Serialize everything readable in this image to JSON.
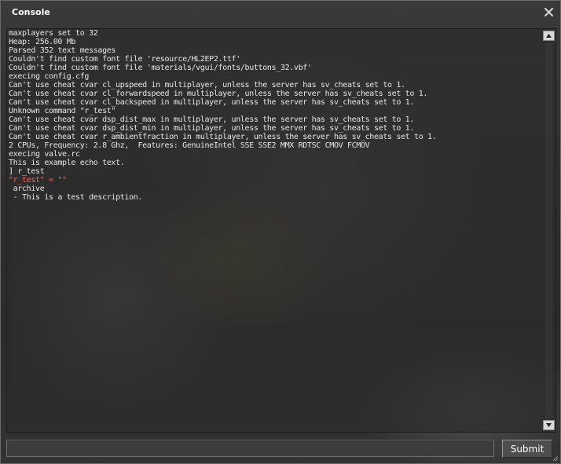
{
  "window": {
    "title": "Console"
  },
  "console": {
    "lines": [
      {
        "text": "maxplayers set to 32",
        "kind": "normal"
      },
      {
        "text": "Heap: 256.00 Mb",
        "kind": "normal"
      },
      {
        "text": "Parsed 352 text messages",
        "kind": "normal"
      },
      {
        "text": "Couldn't find custom font file 'resource/HL2EP2.ttf'",
        "kind": "normal"
      },
      {
        "text": "Couldn't find custom font file 'materials/vgui/fonts/buttons_32.vbf'",
        "kind": "normal"
      },
      {
        "text": "execing config.cfg",
        "kind": "normal"
      },
      {
        "text": "Can't use cheat cvar cl_upspeed in multiplayer, unless the server has sv_cheats set to 1.",
        "kind": "normal"
      },
      {
        "text": "Can't use cheat cvar cl_forwardspeed in multiplayer, unless the server has sv_cheats set to 1.",
        "kind": "normal"
      },
      {
        "text": "Can't use cheat cvar cl_backspeed in multiplayer, unless the server has sv_cheats set to 1.",
        "kind": "normal"
      },
      {
        "text": "Unknown command \"r_test\"",
        "kind": "normal"
      },
      {
        "text": "Can't use cheat cvar dsp_dist_max in multiplayer, unless the server has sv_cheats set to 1.",
        "kind": "normal"
      },
      {
        "text": "Can't use cheat cvar dsp_dist_min in multiplayer, unless the server has sv_cheats set to 1.",
        "kind": "normal"
      },
      {
        "text": "Can't use cheat cvar r_ambientfraction in multiplayer, unless the server has sv_cheats set to 1.",
        "kind": "normal"
      },
      {
        "text": "2 CPUs, Frequency: 2.8 Ghz,  Features: GenuineIntel SSE SSE2 MMX RDTSC CMOV FCMOV",
        "kind": "normal"
      },
      {
        "text": "execing valve.rc",
        "kind": "normal"
      },
      {
        "text": "This is example echo text.",
        "kind": "normal"
      },
      {
        "text": "] r_test",
        "kind": "normal"
      },
      {
        "text": "\"r_test\" = \"\"",
        "kind": "error"
      },
      {
        "text": " archive",
        "kind": "normal"
      },
      {
        "text": " - This is a test description.",
        "kind": "normal"
      }
    ]
  },
  "input": {
    "value": ""
  },
  "submit": {
    "label": "Submit"
  },
  "colors": {
    "text": "#e6e6e6",
    "error": "#ff5a5a",
    "title": "#ffffff"
  },
  "icons": {
    "close": "close-icon",
    "scroll_up": "arrow-up-icon",
    "scroll_down": "arrow-down-icon"
  }
}
